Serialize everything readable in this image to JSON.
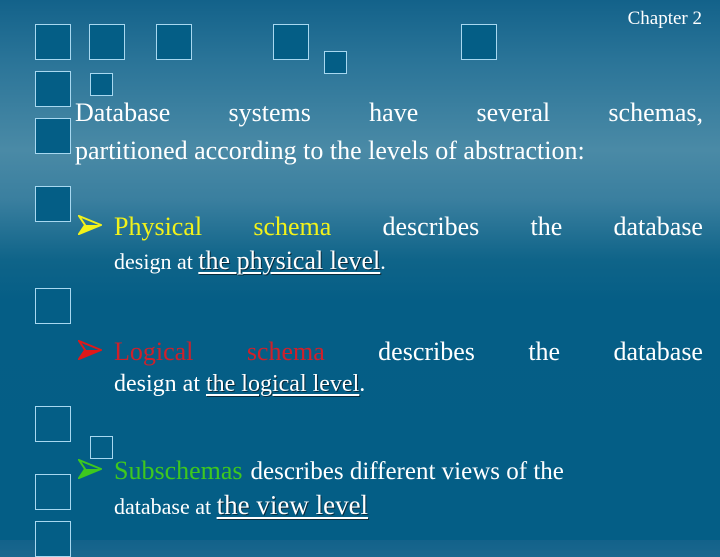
{
  "header": {
    "chapter": "Chapter 2"
  },
  "intro": {
    "line1_words": [
      "Database",
      "systems",
      "have",
      "several",
      "schemas,"
    ],
    "line2": "partitioned according to the levels of abstraction:"
  },
  "bullets": [
    {
      "term": "Physical schema",
      "term_words": [
        "Physical",
        "schema"
      ],
      "term_color": "#f2f21a",
      "desc_words": [
        "describes",
        "the",
        "database"
      ],
      "line2_prefix": "design at ",
      "line2_link": "the physical level",
      "line2_suffix": "."
    },
    {
      "term": "Logical schema",
      "term_words": [
        "Logical",
        "schema"
      ],
      "term_color": "#d0202a",
      "desc_words": [
        "describes",
        "the",
        "database"
      ],
      "line2_prefix": "design at ",
      "line2_link": "the logical level",
      "line2_suffix": "."
    },
    {
      "term": "Subschemas",
      "term_color": "#3ec81e",
      "desc": "describes different views of the",
      "line2_prefix": "database at ",
      "line2_link": "the view level",
      "line2_suffix": ""
    }
  ],
  "icons": {
    "bullet": "arrowhead-bullet-icon",
    "decor": "square-outline-icon"
  },
  "colors": {
    "background_top": "#13628a",
    "background_mid": "#4a8aa6",
    "background_bottom": "#045e86",
    "square_border": "#a8d8f0"
  }
}
